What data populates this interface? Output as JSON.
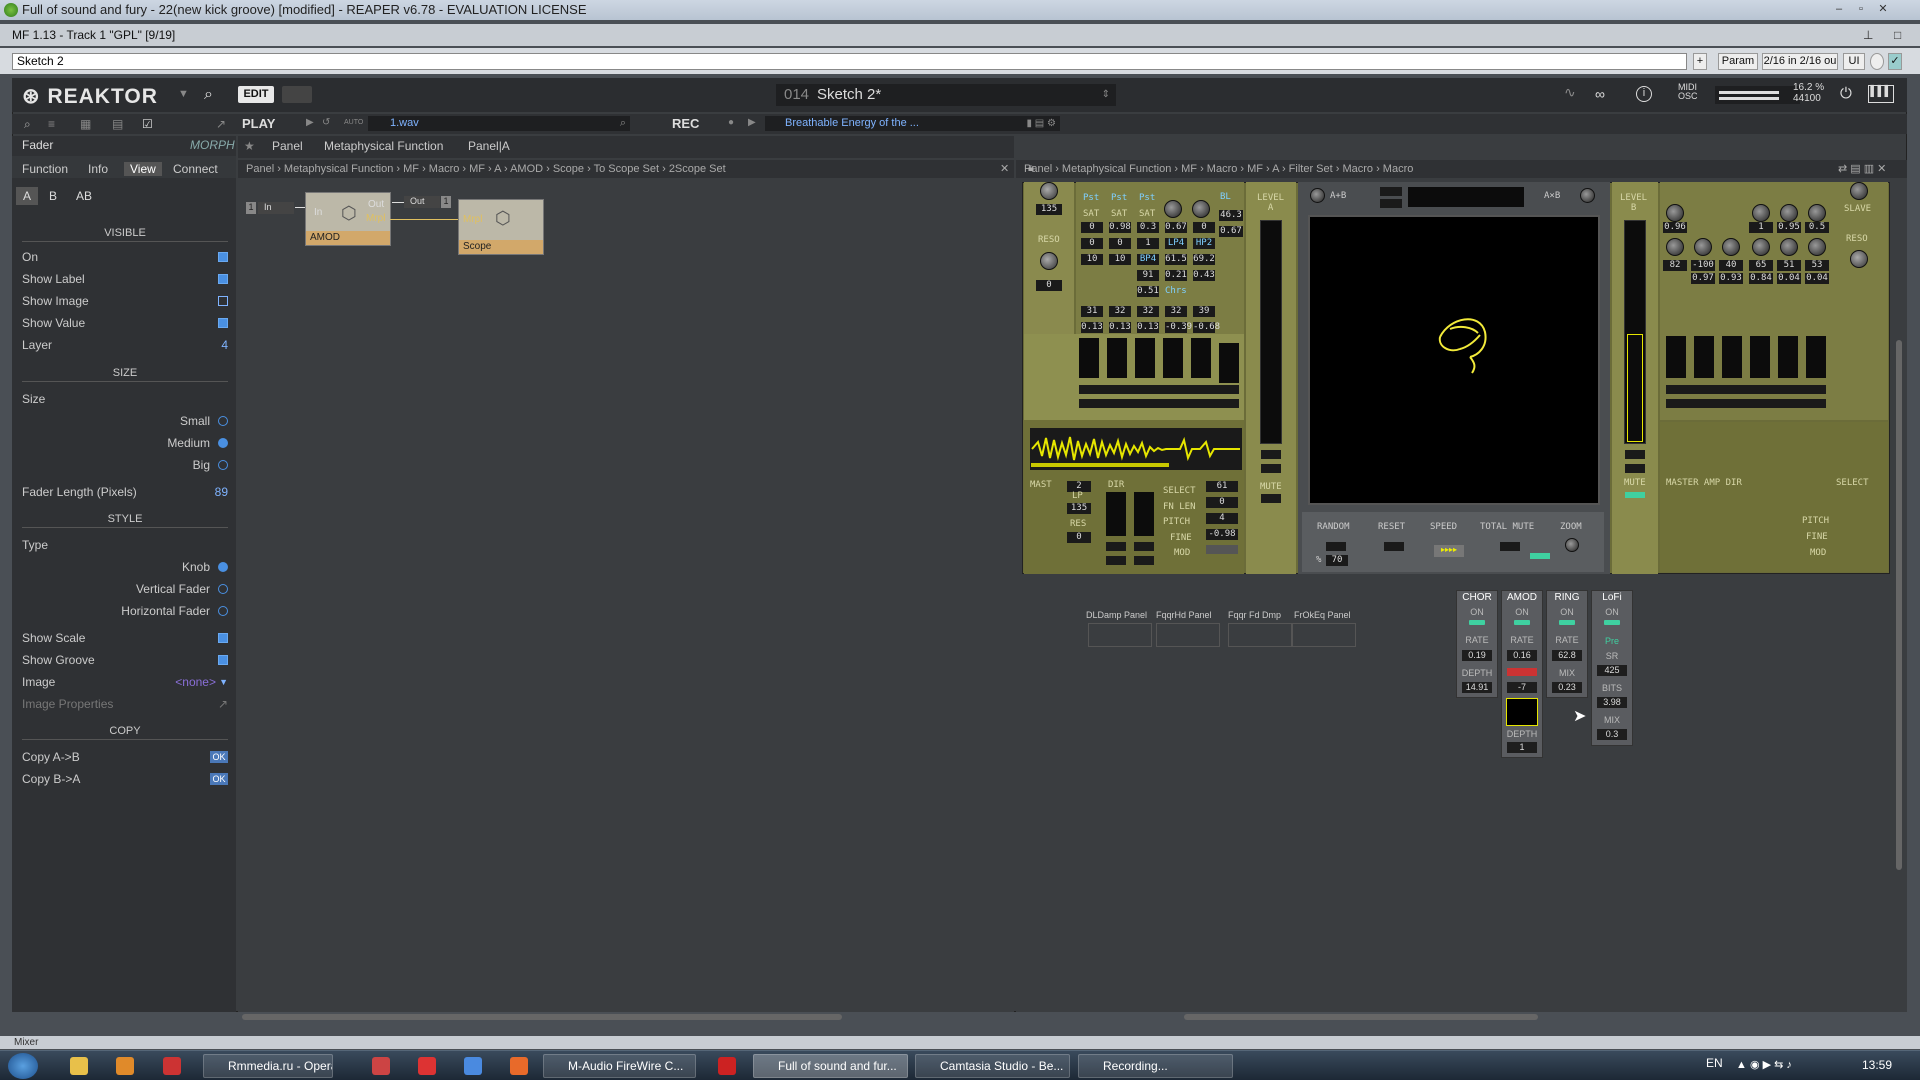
{
  "window": {
    "title": "Full of sound and fury - 22(new kick groove) [modified] - REAPER v6.78 - EVALUATION LICENSE"
  },
  "fx_bar": {
    "title": "MF 1.13 - Track 1 \"GPL\" [9/19]"
  },
  "preset_row": {
    "preset": "Sketch 2",
    "add": "+",
    "param": "Param",
    "io": "2/16 in 2/16 ou",
    "ui": "UI"
  },
  "reaktor": {
    "logo": "REAKTOR",
    "edit": "EDIT",
    "snap_num": "014",
    "snap_name": "Sketch 2*",
    "midi_osc": "MIDI\nOSC",
    "cpu": "16.2 %",
    "srate": "44100",
    "play": "PLAY",
    "auto": "AUTO",
    "wav": "1.wav",
    "rec": "REC",
    "rec_file": "Breathable Energy of the ..."
  },
  "sidebar": {
    "header": "Fader",
    "mode": "MORPH",
    "tabs": [
      "Function",
      "Info",
      "View",
      "Connect"
    ],
    "ab": [
      "A",
      "B",
      "AB"
    ],
    "visible_title": "VISIBLE",
    "visible": [
      {
        "label": "On",
        "type": "chk",
        "on": true
      },
      {
        "label": "Show Label",
        "type": "chk",
        "on": true
      },
      {
        "label": "Show Image",
        "type": "chk",
        "on": false
      },
      {
        "label": "Show Value",
        "type": "chk",
        "on": true
      }
    ],
    "layer_label": "Layer",
    "layer_value": "4",
    "size_title": "SIZE",
    "size_label": "Size",
    "size_options": [
      {
        "label": "Small",
        "on": false
      },
      {
        "label": "Medium",
        "on": true
      },
      {
        "label": "Big",
        "on": false
      }
    ],
    "fader_length_label": "Fader Length (Pixels)",
    "fader_length_value": "89",
    "style_title": "STYLE",
    "type_label": "Type",
    "type_options": [
      {
        "label": "Knob",
        "on": true
      },
      {
        "label": "Vertical Fader",
        "on": false
      },
      {
        "label": "Horizontal Fader",
        "on": false
      }
    ],
    "show_scale": "Show Scale",
    "show_groove": "Show Groove",
    "image_label": "Image",
    "image_value": "<none>",
    "image_props": "Image Properties",
    "copy_title": "COPY",
    "copy_ab": "Copy A->B",
    "copy_ba": "Copy B->A",
    "ok": "OK"
  },
  "structure": {
    "tabs": [
      "Panel",
      "Metaphysical Function",
      "Panel|A"
    ],
    "crumbs": "Panel  ›  Metaphysical Function  ›  MF  ›  Macro  ›  MF  ›  A  ›  AMOD  ›  Scope  ›  To Scope Set  ›  2Scope Set",
    "in_port": "In",
    "in_num": "1",
    "out_port": "Out",
    "out_num": "1",
    "amod_label": "AMOD",
    "scope_label": "Scope",
    "port_in": "In",
    "port_out": "Out",
    "port_mrpl": "Mrpl"
  },
  "panel": {
    "crumbs": "Panel  ›  Metaphysical Function  ›  MF  ›  Macro  ›  MF  ›  A  ›  Filter Set  ›  Macro  ›  Macro",
    "reso_val": "135",
    "reso": "RESO",
    "zero": "0",
    "pst": [
      "Pst",
      "Pst",
      "Pst"
    ],
    "sat": [
      "SAT",
      "SAT",
      "SAT"
    ],
    "bl": "BL",
    "v1": [
      "0",
      "0.98",
      "0.3",
      "0.67",
      "0",
      "46.3"
    ],
    "v2": [
      "0",
      "0",
      "1",
      "LP4",
      "HP2",
      "0.67"
    ],
    "v3": [
      "10",
      "10",
      "BP4",
      "61.5",
      "69.2"
    ],
    "v4": [
      "91",
      "0.21",
      "0.43"
    ],
    "chrs": "Chrs",
    "v5": "0.51",
    "v6": [
      "31",
      "32",
      "32",
      "32",
      "39"
    ],
    "v7": [
      "0.13",
      "0.13",
      "0.13",
      "-0.39",
      "-0.68"
    ],
    "level_a": "LEVEL\nA",
    "level_b": "LEVEL\nB",
    "a_plus_b": "A+B",
    "a_x_b": "A×B",
    "mute": "MUTE",
    "mast": "MAST",
    "dir": "DIR",
    "lp": "LP",
    "res": "RES",
    "select": "SELECT",
    "fn_len": "FN LEN",
    "pitch": "PITCH",
    "fine": "FINE",
    "mod": "MOD",
    "sel_vals": [
      "61",
      "0",
      "4",
      "-0.98"
    ],
    "mast_vals": [
      "2",
      "135",
      "0"
    ],
    "random": "RANDOM",
    "reset": "RESET",
    "speed": "SPEED",
    "total_mute": "TOTAL MUTE",
    "zoom": "ZOOM",
    "pct": "%",
    "rand_val": "70",
    "slave": "SLAVE",
    "b_vals1": [
      "0.96",
      "1",
      "0.95",
      "0.5"
    ],
    "b_vals2": [
      "82",
      "-100",
      "40",
      "65",
      "51",
      "53"
    ],
    "b_vals3": [
      "0.97",
      "0.93",
      "0.84",
      "0.04",
      "0.04"
    ],
    "master_amp_dir": "MASTER AMP DIR",
    "select_b": "SELECT",
    "pitch_b": "PITCH",
    "fine_b": "FINE",
    "mod_b": "MOD"
  },
  "subpanels": [
    "DLDamp Panel",
    "FqqrHd Panel",
    "Fqqr Fd Dmp",
    "FrOkEq Panel"
  ],
  "fx": [
    {
      "name": "CHOR",
      "on": "ON",
      "l1": "RATE",
      "v1": "0.19",
      "l2": "DEPTH",
      "v2": "14.91"
    },
    {
      "name": "AMOD",
      "on": "ON",
      "l1": "RATE",
      "v1": "0.16",
      "l2": "-7",
      "v2": "",
      "l3": "DEPTH",
      "v3": "1"
    },
    {
      "name": "RING",
      "on": "ON",
      "l1": "RATE",
      "v1": "62.8",
      "l2": "MIX",
      "v2": "0.23"
    },
    {
      "name": "LoFi",
      "on": "ON",
      "l1": "Pre",
      "v1": "SR",
      "l2": "425",
      "v2": "BITS",
      "l3": "3.98",
      "v3": "MIX",
      "l4": "0.3"
    }
  ],
  "mixer_label": "Mixer",
  "taskbar": {
    "items": [
      "Rmmedia.ru - Opera",
      "M-Audio FireWire C...",
      "Full of sound and fur...",
      "Camtasia Studio - Be...",
      "Recording..."
    ],
    "lang": "EN",
    "clock": "13:59"
  },
  "colors": {
    "accent": "#4a90e2",
    "panel_olive": "#6b6c39",
    "scope_trace": "#f2ea3a",
    "waveform": "#e6e600"
  }
}
